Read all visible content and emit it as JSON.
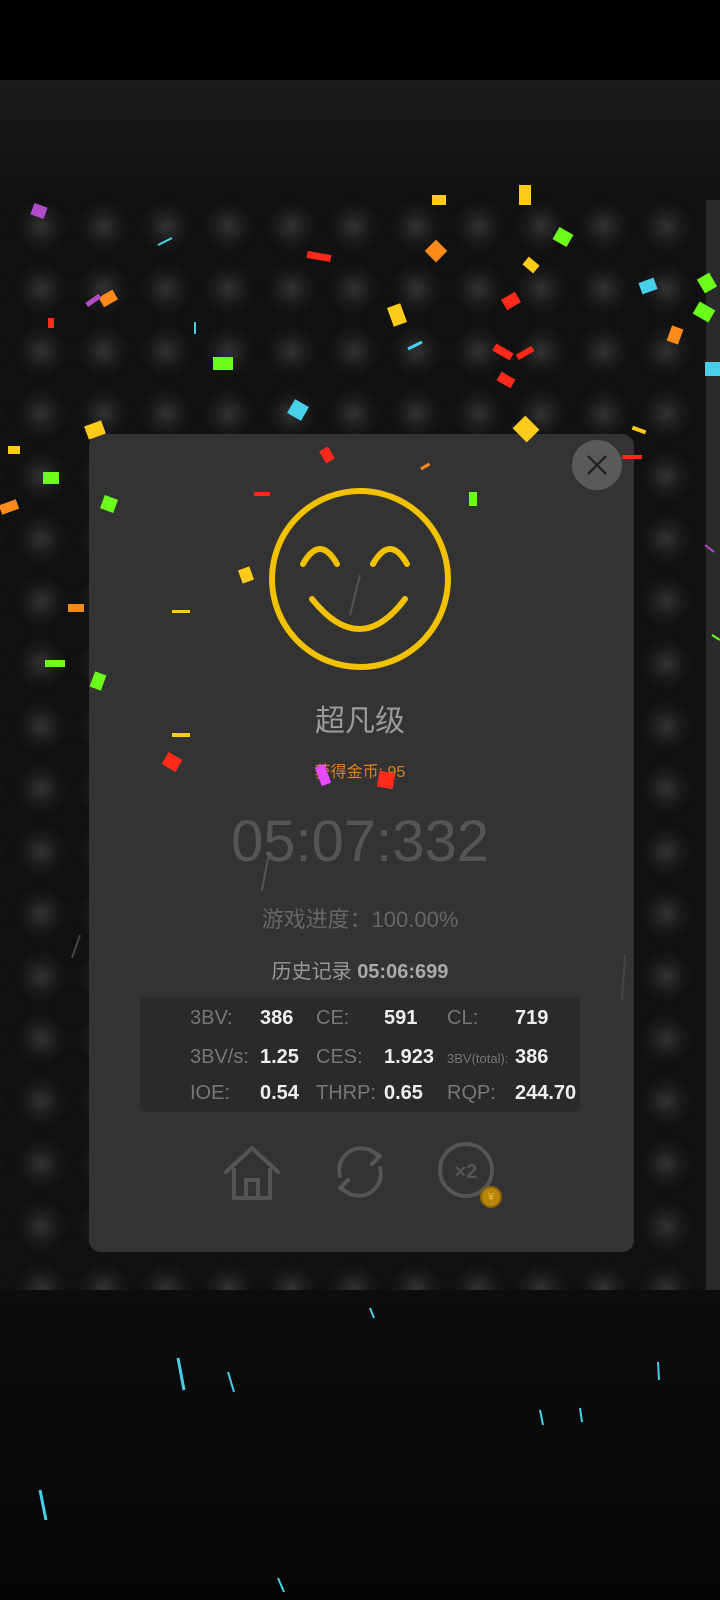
{
  "dialog": {
    "rank_title": "超凡级",
    "coins_text": "获得金币: 95",
    "timer": "05:07:332",
    "progress": "游戏进度：100.00%",
    "history_label": "历史记录",
    "history_value": "05:06:699"
  },
  "stats": [
    {
      "label": "3BV:",
      "value": "386"
    },
    {
      "label": "CE:",
      "value": "591"
    },
    {
      "label": "CL:",
      "value": "719"
    },
    {
      "label": "3BV/s:",
      "value": "1.25"
    },
    {
      "label": "CES:",
      "value": "1.923"
    },
    {
      "label": "3BV(total):",
      "value": "386"
    },
    {
      "label": "IOE:",
      "value": "0.54"
    },
    {
      "label": "THRP:",
      "value": "0.65"
    },
    {
      "label": "RQP:",
      "value": "244.70"
    }
  ],
  "actions": {
    "home": "home-icon",
    "restart": "restart-icon",
    "double": "×2"
  },
  "colors": {
    "smiley": "#f2c200",
    "coins_text": "#e08020",
    "dialog_bg": "#333333"
  }
}
